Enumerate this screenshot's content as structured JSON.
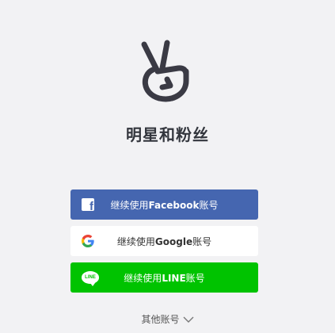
{
  "app": {
    "title": "明星和粉丝"
  },
  "logo": {
    "icon": "v-hand-icon",
    "color": "#3a3a44"
  },
  "login_buttons": [
    {
      "provider": "facebook",
      "prefix": "继续使用",
      "brand": "Facebook",
      "suffix": "账号",
      "icon": "facebook-icon",
      "color": "#4566b0"
    },
    {
      "provider": "google",
      "prefix": "继续使用",
      "brand": "Google",
      "suffix": "账号",
      "icon": "google-icon",
      "color": "#ffffff"
    },
    {
      "provider": "line",
      "prefix": "继续使用",
      "brand": "LINE",
      "suffix": "账号",
      "icon": "line-icon",
      "icon_text": "LINE",
      "color": "#00c300"
    }
  ],
  "other_accounts": {
    "label": "其他账号",
    "icon": "chevron-down-icon"
  }
}
